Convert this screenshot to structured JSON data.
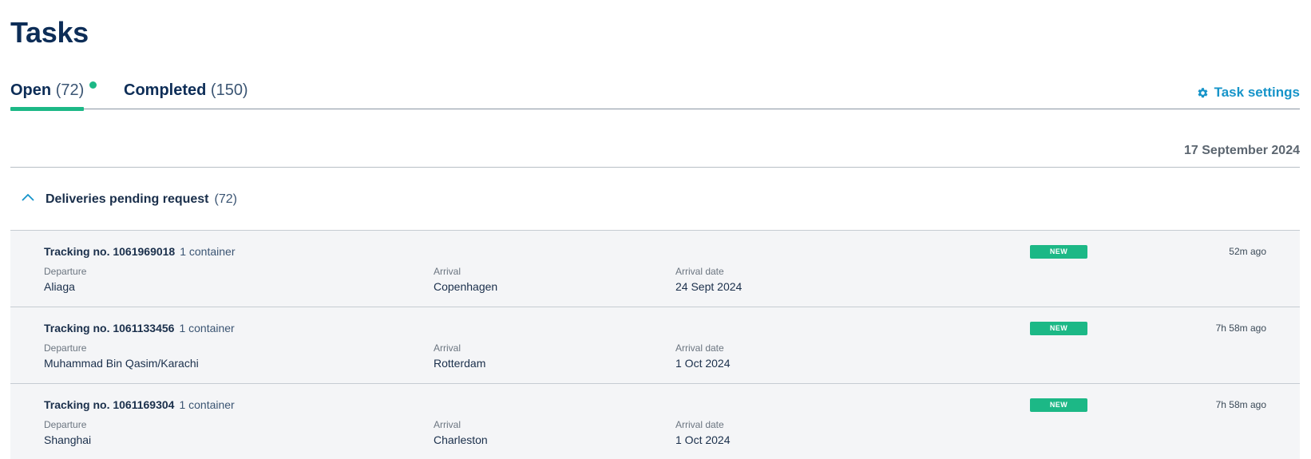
{
  "page": {
    "title": "Tasks"
  },
  "tabs": [
    {
      "label": "Open",
      "count": "(72)",
      "active": true
    },
    {
      "label": "Completed",
      "count": "(150)",
      "active": false
    }
  ],
  "task_settings": {
    "label": "Task settings",
    "icon": "gear-icon"
  },
  "date_header": "17 September 2024",
  "group": {
    "title": "Deliveries pending request",
    "count": "(72)",
    "icon": "chevron-up-icon"
  },
  "labels": {
    "departure": "Departure",
    "arrival": "Arrival",
    "arrival_date": "Arrival date"
  },
  "tasks": [
    {
      "tracking": "Tracking no. 1061969018",
      "containers": "1 container",
      "departure": "Aliaga",
      "arrival": "Copenhagen",
      "arrival_date": "24 Sept 2024",
      "badge": "NEW",
      "ago": "52m ago"
    },
    {
      "tracking": "Tracking no. 1061133456",
      "containers": "1 container",
      "departure": "Muhammad Bin Qasim/Karachi",
      "arrival": "Rotterdam",
      "arrival_date": "1 Oct 2024",
      "badge": "NEW",
      "ago": "7h 58m ago"
    },
    {
      "tracking": "Tracking no. 1061169304",
      "containers": "1 container",
      "departure": "Shanghai",
      "arrival": "Charleston",
      "arrival_date": "1 Oct 2024",
      "badge": "NEW",
      "ago": "7h 58m ago"
    }
  ],
  "colors": {
    "title": "#0d2d57",
    "accent_green": "#1cb886",
    "link_blue": "#1694c9",
    "row_bg": "#f4f5f7"
  }
}
